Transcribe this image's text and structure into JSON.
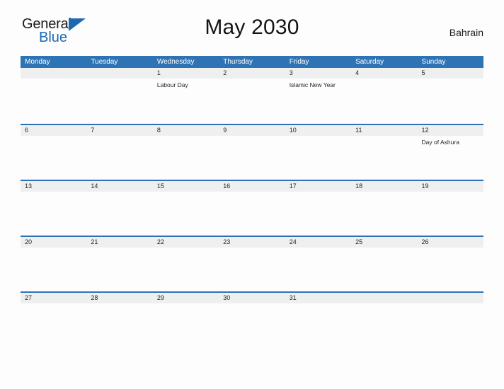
{
  "brand": {
    "name_top": "General",
    "name_bottom": "Blue",
    "triangle_color": "#1b69b0"
  },
  "header": {
    "title": "May 2030",
    "country": "Bahrain"
  },
  "theme": {
    "accent": "#2e74b5",
    "date_band": "#efefef",
    "page_background": "#fdfdfd",
    "text": "#262626"
  },
  "calendar": {
    "weekdays": [
      "Monday",
      "Tuesday",
      "Wednesday",
      "Thursday",
      "Friday",
      "Saturday",
      "Sunday"
    ],
    "weeks": [
      [
        {
          "date": "",
          "events": []
        },
        {
          "date": "",
          "events": []
        },
        {
          "date": "1",
          "events": [
            "Labour Day"
          ]
        },
        {
          "date": "2",
          "events": []
        },
        {
          "date": "3",
          "events": [
            "Islamic New Year"
          ]
        },
        {
          "date": "4",
          "events": []
        },
        {
          "date": "5",
          "events": []
        }
      ],
      [
        {
          "date": "6",
          "events": []
        },
        {
          "date": "7",
          "events": []
        },
        {
          "date": "8",
          "events": []
        },
        {
          "date": "9",
          "events": []
        },
        {
          "date": "10",
          "events": []
        },
        {
          "date": "11",
          "events": []
        },
        {
          "date": "12",
          "events": [
            "Day of Ashura"
          ]
        }
      ],
      [
        {
          "date": "13",
          "events": []
        },
        {
          "date": "14",
          "events": []
        },
        {
          "date": "15",
          "events": []
        },
        {
          "date": "16",
          "events": []
        },
        {
          "date": "17",
          "events": []
        },
        {
          "date": "18",
          "events": []
        },
        {
          "date": "19",
          "events": []
        }
      ],
      [
        {
          "date": "20",
          "events": []
        },
        {
          "date": "21",
          "events": []
        },
        {
          "date": "22",
          "events": []
        },
        {
          "date": "23",
          "events": []
        },
        {
          "date": "24",
          "events": []
        },
        {
          "date": "25",
          "events": []
        },
        {
          "date": "26",
          "events": []
        }
      ],
      [
        {
          "date": "27",
          "events": []
        },
        {
          "date": "28",
          "events": []
        },
        {
          "date": "29",
          "events": []
        },
        {
          "date": "30",
          "events": []
        },
        {
          "date": "31",
          "events": []
        },
        {
          "date": "",
          "events": []
        },
        {
          "date": "",
          "events": []
        }
      ]
    ]
  }
}
